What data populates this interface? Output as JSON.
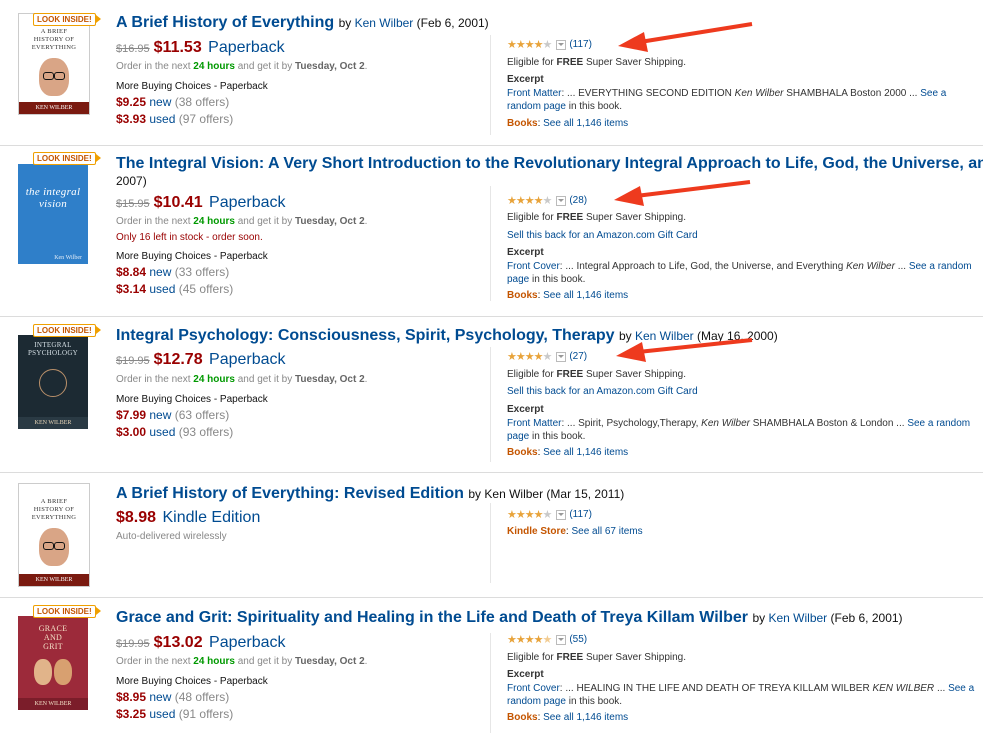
{
  "colors": {
    "link": "#004b91",
    "price": "#990000",
    "green": "#009900",
    "store": "#c45500",
    "star": "#e8a33a",
    "arrow": "#ee3a1e"
  },
  "results": [
    {
      "look_inside": "LOOK INSIDE!",
      "cover": {
        "title": "A BRIEF HISTORY OF EVERYTHING",
        "author": "KEN WILBER"
      },
      "title": "A Brief History of Everything",
      "by": "by",
      "author": "Ken Wilber",
      "date": "(Feb 6, 2001)",
      "list_price": "$16.95",
      "price": "$11.53",
      "format": "Paperback",
      "order_pre": "Order in the next",
      "order_hours": "24 hours",
      "order_mid": "and get it by",
      "order_date": "Tuesday, Oct 2",
      "more_buying": "More Buying Choices - Paperback",
      "new_price": "$9.25",
      "new_label": "new",
      "new_offers": "(38 offers)",
      "used_price": "$3.93",
      "used_label": "used",
      "used_offers": "(97 offers)",
      "rating": 4.0,
      "review_count": "(117)",
      "shipping_pre": "Eligible for",
      "shipping_free": "FREE",
      "shipping_post": "Super Saver Shipping.",
      "excerpt_label": "Excerpt",
      "excerpt_src": "Front Matter",
      "excerpt_text": ": ... EVERYTHING SECOND EDITION",
      "excerpt_italic": "Ken Wilber",
      "excerpt_tail": "SHAMBHALA Boston 2000 ...",
      "see_page": "See a random page",
      "see_page_tail": "in this book.",
      "store": "Books",
      "see_all": "See all 1,146 items"
    },
    {
      "look_inside": "LOOK INSIDE!",
      "cover": {
        "title": "the integral vision",
        "author": "Ken Wilber"
      },
      "title": "The Integral Vision: A Very Short Introduction to the Revolutionary Integral Approach to Life, God, the Universe, and",
      "title_cont": "2007)",
      "list_price": "$15.95",
      "price": "$10.41",
      "format": "Paperback",
      "order_pre": "Order in the next",
      "order_hours": "24 hours",
      "order_mid": "and get it by",
      "order_date": "Tuesday, Oct 2",
      "stock": "Only 16 left in stock - order soon.",
      "more_buying": "More Buying Choices - Paperback",
      "new_price": "$8.84",
      "new_label": "new",
      "new_offers": "(33 offers)",
      "used_price": "$3.14",
      "used_label": "used",
      "used_offers": "(45 offers)",
      "rating": 4.0,
      "review_count": "(28)",
      "shipping_pre": "Eligible for",
      "shipping_free": "FREE",
      "shipping_post": "Super Saver Shipping.",
      "gift": "Sell this back for an Amazon.com Gift Card",
      "excerpt_label": "Excerpt",
      "excerpt_src": "Front Cover",
      "excerpt_text": ": ... Integral Approach to Life, God, the Universe, and Everything",
      "excerpt_italic": "Ken Wilber",
      "excerpt_tail": "...",
      "see_page": "See a random page",
      "see_page_tail": "in this book.",
      "store": "Books",
      "see_all": "See all 1,146 items"
    },
    {
      "look_inside": "LOOK INSIDE!",
      "cover": {
        "title": "INTEGRAL PSYCHOLOGY",
        "author": "KEN WILBER"
      },
      "title": "Integral Psychology: Consciousness, Spirit, Psychology, Therapy",
      "by": "by",
      "author": "Ken Wilber",
      "date": "(May 16, 2000)",
      "list_price": "$19.95",
      "price": "$12.78",
      "format": "Paperback",
      "order_pre": "Order in the next",
      "order_hours": "24 hours",
      "order_mid": "and get it by",
      "order_date": "Tuesday, Oct 2",
      "more_buying": "More Buying Choices - Paperback",
      "new_price": "$7.99",
      "new_label": "new",
      "new_offers": "(63 offers)",
      "used_price": "$3.00",
      "used_label": "used",
      "used_offers": "(93 offers)",
      "rating": 4.0,
      "review_count": "(27)",
      "shipping_pre": "Eligible for",
      "shipping_free": "FREE",
      "shipping_post": "Super Saver Shipping.",
      "gift": "Sell this back for an Amazon.com Gift Card",
      "excerpt_label": "Excerpt",
      "excerpt_src": "Front Matter",
      "excerpt_text": ": ... Spirit, Psychology,Therapy,",
      "excerpt_italic": "Ken Wilber",
      "excerpt_tail": "SHAMBHALA Boston & London ...",
      "see_page": "See a random page",
      "see_page_tail": "in this book.",
      "store": "Books",
      "see_all": "See all 1,146 items"
    },
    {
      "cover": {
        "title": "A BRIEF HISTORY OF EVERYTHING",
        "author": "KEN WILBER"
      },
      "title": "A Brief History of Everything: Revised Edition",
      "by": "by",
      "author": "Ken Wilber",
      "date": "(Mar 15, 2011)",
      "price": "$8.98",
      "format": "Kindle Edition",
      "delivered": "Auto-delivered wirelessly",
      "rating": 4.0,
      "review_count": "(117)",
      "store": "Kindle Store",
      "see_all": "See all 67 items"
    },
    {
      "look_inside": "LOOK INSIDE!",
      "cover": {
        "title": "GRACE AND GRIT",
        "author": "KEN WILBER"
      },
      "title": "Grace and Grit: Spirituality and Healing in the Life and Death of Treya Killam Wilber",
      "by": "by",
      "author": "Ken Wilber",
      "date": "(Feb 6, 2001)",
      "list_price": "$19.95",
      "price": "$13.02",
      "format": "Paperback",
      "order_pre": "Order in the next",
      "order_hours": "24 hours",
      "order_mid": "and get it by",
      "order_date": "Tuesday, Oct 2",
      "more_buying": "More Buying Choices - Paperback",
      "new_price": "$8.95",
      "new_label": "new",
      "new_offers": "(48 offers)",
      "used_price": "$3.25",
      "used_label": "used",
      "used_offers": "(91 offers)",
      "rating": 4.5,
      "review_count": "(55)",
      "shipping_pre": "Eligible for",
      "shipping_free": "FREE",
      "shipping_post": "Super Saver Shipping.",
      "excerpt_label": "Excerpt",
      "excerpt_src": "Front Cover",
      "excerpt_text": ": ... HEALING IN THE LIFE AND DEATH OF TREYA KILLAM WILBER",
      "excerpt_italic": "KEN WILBER",
      "excerpt_tail": "...",
      "see_page": "See a random page",
      "see_page_tail": "in this book.",
      "store": "Books",
      "see_all": "See all 1,146 items"
    }
  ]
}
